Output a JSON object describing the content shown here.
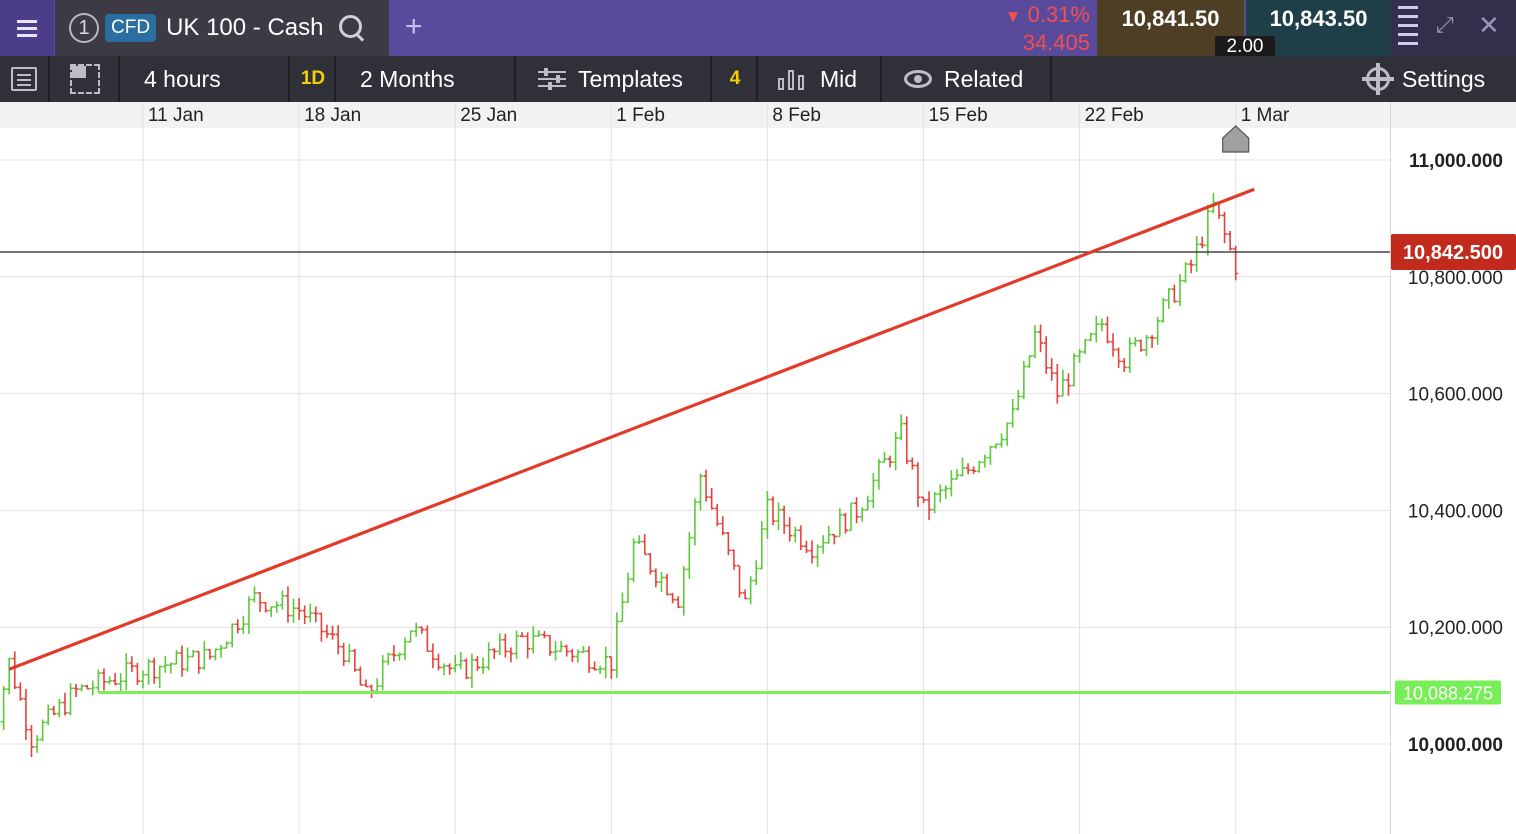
{
  "header": {
    "tab_number": "1",
    "instrument_type": "CFD",
    "market_name": "UK 100 - Cash",
    "add_tab": "+",
    "change_percent": "0.31%",
    "change_points": "34.405",
    "sell_price": "10,841.50",
    "buy_price": "10,843.50",
    "spread": "2.00"
  },
  "toolbar": {
    "interval": "4 hours",
    "interval_short": "1D",
    "range": "2 Months",
    "templates": "Templates",
    "indicator_count": "4",
    "price_type": "Mid",
    "related": "Related",
    "settings": "Settings"
  },
  "icons": [
    "menu-icon",
    "search-icon",
    "list-icon",
    "layout-icon",
    "templates-icon",
    "candles-icon",
    "eye-icon",
    "gear-icon",
    "depth-icon",
    "expand-icon",
    "close-icon",
    "flag-marker-icon"
  ],
  "colors": {
    "up": "#5dc93a",
    "down": "#e8403a",
    "trendline": "#e23b2c",
    "support": "#78ee58",
    "current_price_label": "#c22a1e",
    "header_bg": "#5a4a9c",
    "toolbar_bg": "#303038"
  },
  "chart_data": {
    "type": "candlestick",
    "x_tick_labels": [
      "11 Jan",
      "18 Jan",
      "25 Jan",
      "1 Feb",
      "8 Feb",
      "15 Feb",
      "22 Feb",
      "1 Mar"
    ],
    "y_tick_labels": [
      "11,000.000",
      "10,800.000",
      "10,600.000",
      "10,400.000",
      "10,200.000",
      "10,000.000"
    ],
    "y_ticks": [
      11000,
      10800,
      10600,
      10400,
      10200,
      10000
    ],
    "ylim": [
      9850,
      11060
    ],
    "current_price": 10842.5,
    "current_price_label": "10,842.500",
    "support_level": 10088.275,
    "support_label": "10,088.275",
    "trendline": {
      "start": {
        "date": "2021-01-05",
        "value": 10128
      },
      "end": {
        "date": "2021-03-01 20:00",
        "value": 10950
      }
    },
    "anchors": [
      {
        "date": "2021-01-04",
        "value": 9970
      },
      {
        "date": "2021-01-05",
        "value": 10140
      },
      {
        "date": "2021-01-06",
        "value": 10010
      },
      {
        "date": "2021-01-08",
        "value": 10090
      },
      {
        "date": "2021-01-11",
        "value": 10130
      },
      {
        "date": "2021-01-14",
        "value": 10150
      },
      {
        "date": "2021-01-16",
        "value": 10250
      },
      {
        "date": "2021-01-18",
        "value": 10230
      },
      {
        "date": "2021-01-20",
        "value": 10160
      },
      {
        "date": "2021-01-21",
        "value": 10080
      },
      {
        "date": "2021-01-23",
        "value": 10200
      },
      {
        "date": "2021-01-25",
        "value": 10120
      },
      {
        "date": "2021-01-28",
        "value": 10180
      },
      {
        "date": "2021-01-30",
        "value": 10160
      },
      {
        "date": "2021-02-01",
        "value": 10140
      },
      {
        "date": "2021-02-02",
        "value": 10340
      },
      {
        "date": "2021-02-04",
        "value": 10250
      },
      {
        "date": "2021-02-05",
        "value": 10460
      },
      {
        "date": "2021-02-07",
        "value": 10240
      },
      {
        "date": "2021-02-08",
        "value": 10400
      },
      {
        "date": "2021-02-10",
        "value": 10340
      },
      {
        "date": "2021-02-12",
        "value": 10400
      },
      {
        "date": "2021-02-14",
        "value": 10530
      },
      {
        "date": "2021-02-15",
        "value": 10400
      },
      {
        "date": "2021-02-17",
        "value": 10470
      },
      {
        "date": "2021-02-19",
        "value": 10560
      },
      {
        "date": "2021-02-20",
        "value": 10700
      },
      {
        "date": "2021-02-21",
        "value": 10600
      },
      {
        "date": "2021-02-23",
        "value": 10720
      },
      {
        "date": "2021-02-24",
        "value": 10660
      },
      {
        "date": "2021-02-25",
        "value": 10700
      },
      {
        "date": "2021-02-27",
        "value": 10820
      },
      {
        "date": "2021-02-28",
        "value": 10920
      },
      {
        "date": "2021-03-01",
        "value": 10820
      },
      {
        "date": "2021-03-01 04:00",
        "value": 10842
      }
    ],
    "x_start": "2021-01-04",
    "x_tick_dates": [
      "2021-01-11",
      "2021-01-18",
      "2021-01-25",
      "2021-02-01",
      "2021-02-08",
      "2021-02-15",
      "2021-02-22",
      "2021-03-01"
    ],
    "marker_date": "2021-03-01",
    "grid": true
  }
}
